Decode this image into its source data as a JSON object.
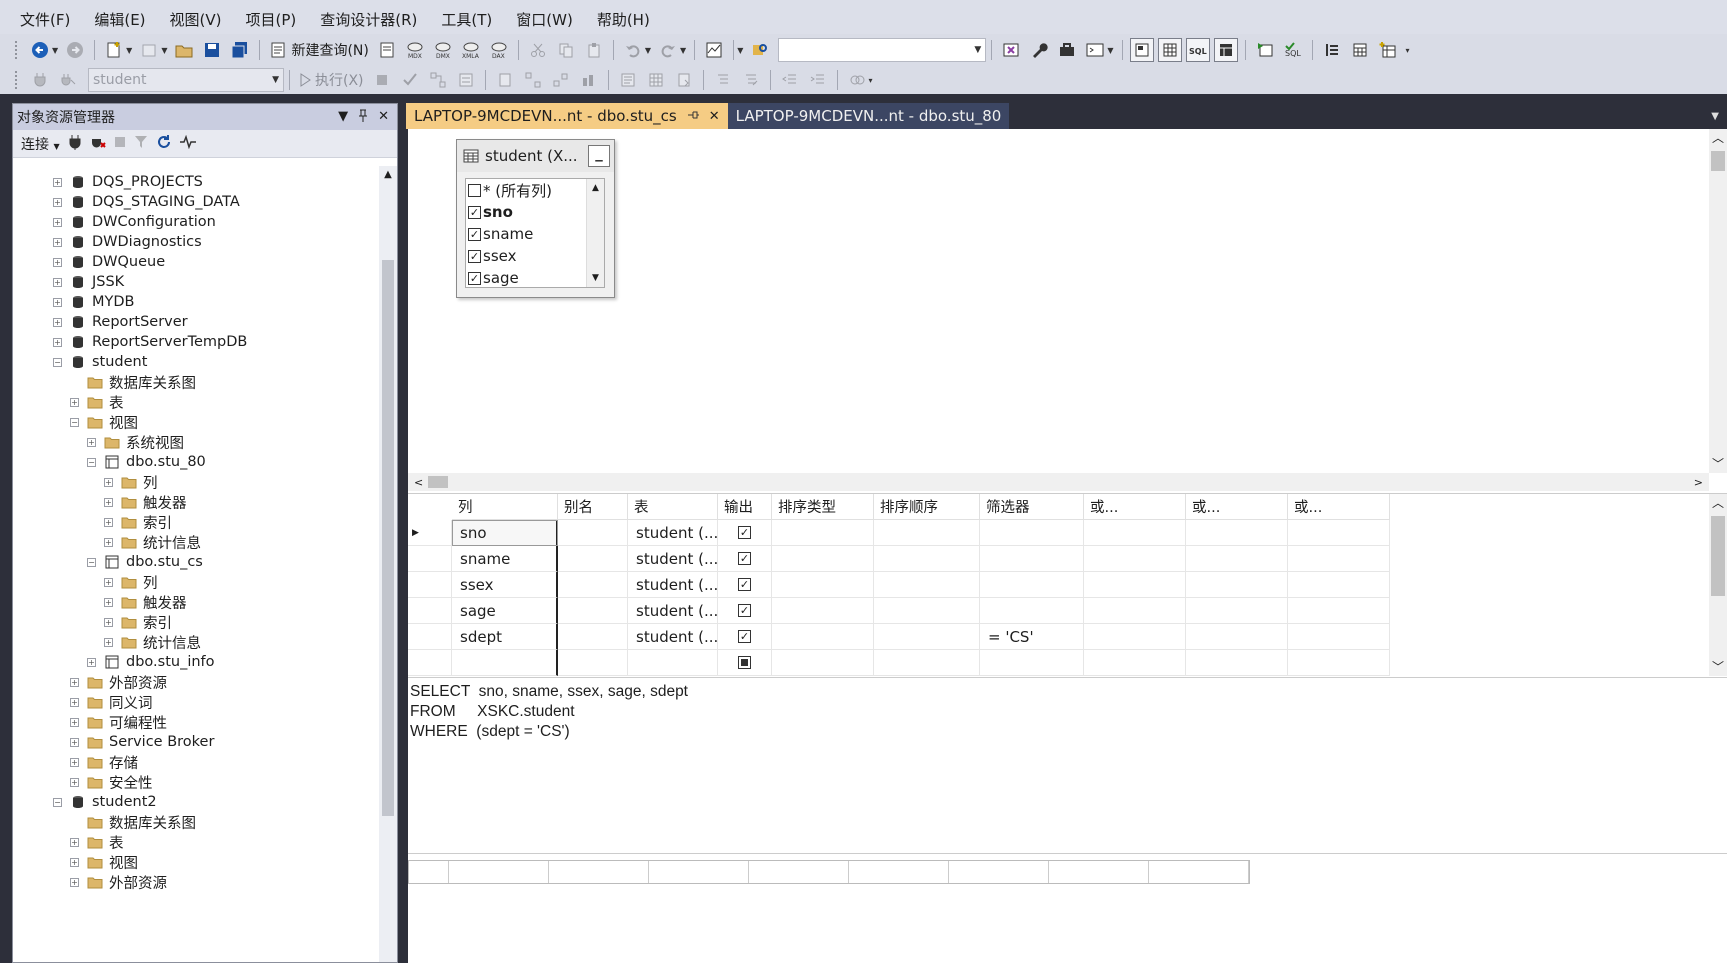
{
  "menu": [
    "文件(F)",
    "编辑(E)",
    "视图(V)",
    "项目(P)",
    "查询设计器(R)",
    "工具(T)",
    "窗口(W)",
    "帮助(H)"
  ],
  "toolbar": {
    "new_query_label": "新建查询(N)",
    "database_combo_value": "student",
    "execute_label": "执行(X)",
    "search_combo_value": ""
  },
  "object_explorer": {
    "title": "对象资源管理器",
    "connect_label": "连接",
    "tree": [
      {
        "label": "DQS_PROJECTS",
        "level": 0,
        "icon": "database-icon",
        "expander": "+"
      },
      {
        "label": "DQS_STAGING_DATA",
        "level": 0,
        "icon": "database-icon",
        "expander": "+"
      },
      {
        "label": "DWConfiguration",
        "level": 0,
        "icon": "database-icon",
        "expander": "+"
      },
      {
        "label": "DWDiagnostics",
        "level": 0,
        "icon": "database-icon",
        "expander": "+"
      },
      {
        "label": "DWQueue",
        "level": 0,
        "icon": "database-icon",
        "expander": "+"
      },
      {
        "label": "JSSK",
        "level": 0,
        "icon": "database-icon",
        "expander": "+"
      },
      {
        "label": "MYDB",
        "level": 0,
        "icon": "database-icon",
        "expander": "+"
      },
      {
        "label": "ReportServer",
        "level": 0,
        "icon": "database-icon",
        "expander": "+"
      },
      {
        "label": "ReportServerTempDB",
        "level": 0,
        "icon": "database-icon",
        "expander": "+"
      },
      {
        "label": "student",
        "level": 0,
        "icon": "database-icon",
        "expander": "-"
      },
      {
        "label": "数据库关系图",
        "level": 1,
        "icon": "folder-icon",
        "expander": ""
      },
      {
        "label": "表",
        "level": 1,
        "icon": "folder-icon",
        "expander": "+"
      },
      {
        "label": "视图",
        "level": 1,
        "icon": "folder-icon",
        "expander": "-"
      },
      {
        "label": "系统视图",
        "level": 2,
        "icon": "folder-icon",
        "expander": "+"
      },
      {
        "label": "dbo.stu_80",
        "level": 2,
        "icon": "view-icon",
        "expander": "-"
      },
      {
        "label": "列",
        "level": 3,
        "icon": "folder-icon",
        "expander": "+"
      },
      {
        "label": "触发器",
        "level": 3,
        "icon": "folder-icon",
        "expander": "+"
      },
      {
        "label": "索引",
        "level": 3,
        "icon": "folder-icon",
        "expander": "+"
      },
      {
        "label": "统计信息",
        "level": 3,
        "icon": "folder-icon",
        "expander": "+"
      },
      {
        "label": "dbo.stu_cs",
        "level": 2,
        "icon": "view-icon",
        "expander": "-"
      },
      {
        "label": "列",
        "level": 3,
        "icon": "folder-icon",
        "expander": "+"
      },
      {
        "label": "触发器",
        "level": 3,
        "icon": "folder-icon",
        "expander": "+"
      },
      {
        "label": "索引",
        "level": 3,
        "icon": "folder-icon",
        "expander": "+"
      },
      {
        "label": "统计信息",
        "level": 3,
        "icon": "folder-icon",
        "expander": "+"
      },
      {
        "label": "dbo.stu_info",
        "level": 2,
        "icon": "view-icon",
        "expander": "+"
      },
      {
        "label": "外部资源",
        "level": 1,
        "icon": "folder-icon",
        "expander": "+"
      },
      {
        "label": "同义词",
        "level": 1,
        "icon": "folder-icon",
        "expander": "+"
      },
      {
        "label": "可编程性",
        "level": 1,
        "icon": "folder-icon",
        "expander": "+"
      },
      {
        "label": "Service Broker",
        "level": 1,
        "icon": "folder-icon",
        "expander": "+"
      },
      {
        "label": "存储",
        "level": 1,
        "icon": "folder-icon",
        "expander": "+"
      },
      {
        "label": "安全性",
        "level": 1,
        "icon": "folder-icon",
        "expander": "+"
      },
      {
        "label": "student2",
        "level": 0,
        "icon": "database-icon",
        "expander": "-"
      },
      {
        "label": "数据库关系图",
        "level": 1,
        "icon": "folder-icon",
        "expander": ""
      },
      {
        "label": "表",
        "level": 1,
        "icon": "folder-icon",
        "expander": "+"
      },
      {
        "label": "视图",
        "level": 1,
        "icon": "folder-icon",
        "expander": "+"
      },
      {
        "label": "外部资源",
        "level": 1,
        "icon": "folder-icon",
        "expander": "+"
      }
    ]
  },
  "tabs": [
    {
      "label": "LAPTOP-9MCDEVN...nt - dbo.stu_cs",
      "active": true
    },
    {
      "label": "LAPTOP-9MCDEVN...nt - dbo.stu_80",
      "active": false
    }
  ],
  "diagram": {
    "table_title": "student (X...",
    "columns": [
      {
        "name": "* (所有列)",
        "checked": false,
        "bold": false
      },
      {
        "name": "sno",
        "checked": true,
        "bold": true
      },
      {
        "name": "sname",
        "checked": true,
        "bold": false
      },
      {
        "name": "ssex",
        "checked": true,
        "bold": false
      },
      {
        "name": "sage",
        "checked": true,
        "bold": false
      }
    ]
  },
  "criteria": {
    "headers": [
      "列",
      "别名",
      "表",
      "输出",
      "排序类型",
      "排序顺序",
      "筛选器",
      "或...",
      "或...",
      "或..."
    ],
    "rows": [
      {
        "column": "sno",
        "alias": "",
        "table": "student (...",
        "output": true,
        "filter": ""
      },
      {
        "column": "sname",
        "alias": "",
        "table": "student (...",
        "output": true,
        "filter": ""
      },
      {
        "column": "ssex",
        "alias": "",
        "table": "student (...",
        "output": true,
        "filter": ""
      },
      {
        "column": "sage",
        "alias": "",
        "table": "student (...",
        "output": true,
        "filter": ""
      },
      {
        "column": "sdept",
        "alias": "",
        "table": "student (...",
        "output": true,
        "filter": "= 'CS'"
      }
    ]
  },
  "sql": [
    "SELECT  sno, sname, ssex, sage, sdept",
    "FROM     XSKC.student",
    "WHERE  (sdept = 'CS')"
  ],
  "colors": {
    "active_tab": "#f5cc84",
    "inactive_tab": "#3c4663",
    "chrome_dark": "#2d2f3a",
    "toolbar_bg": "#d9dce6",
    "panel_title": "#c9cde0"
  }
}
